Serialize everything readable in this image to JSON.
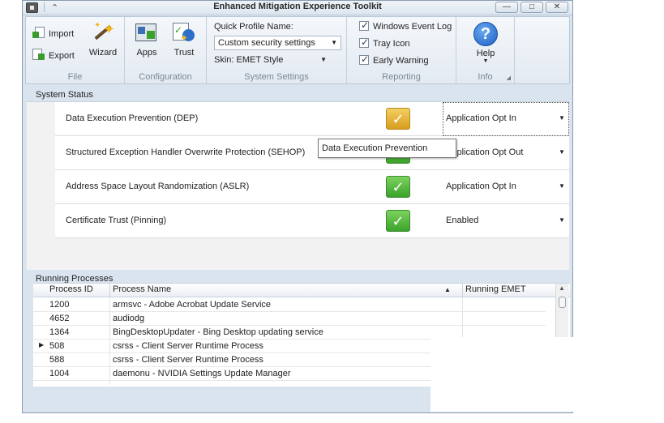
{
  "window": {
    "title": "Enhanced Mitigation Experience Toolkit",
    "controls": {
      "minimize": "—",
      "maximize": "□",
      "close": "✕"
    },
    "qat_arrow": "⌃"
  },
  "ribbon": {
    "file": {
      "label": "File",
      "import": "Import",
      "export": "Export",
      "wizard": "Wizard"
    },
    "configuration": {
      "label": "Configuration",
      "apps": "Apps",
      "trust": "Trust"
    },
    "system_settings": {
      "label": "System Settings",
      "quick_profile_label": "Quick Profile Name:",
      "quick_profile_value": "Custom security settings",
      "skin_label": "Skin: EMET Style"
    },
    "reporting": {
      "label": "Reporting",
      "windows_event_log": "Windows Event Log",
      "tray_icon": "Tray Icon",
      "early_warning": "Early Warning"
    },
    "info": {
      "label": "Info",
      "help": "Help"
    }
  },
  "system_status": {
    "header": "System Status",
    "rows": [
      {
        "name": "Data Execution Prevention (DEP)",
        "mode": "Application Opt In",
        "state": "warning"
      },
      {
        "name": "Structured Exception Handler Overwrite Protection (SEHOP)",
        "mode": "Application Opt Out",
        "state": "ok"
      },
      {
        "name": "Address Space Layout Randomization (ASLR)",
        "mode": "Application Opt In",
        "state": "ok"
      },
      {
        "name": "Certificate Trust (Pinning)",
        "mode": "Enabled",
        "state": "ok"
      }
    ],
    "tooltip": "Data Execution Prevention"
  },
  "running_processes": {
    "header": "Running Processes",
    "columns": [
      "Process ID",
      "Process Name",
      "Running EMET"
    ],
    "sort_indicator": "▲",
    "rows": [
      {
        "pid": "1200",
        "name": "armsvc - Adobe Acrobat Update Service",
        "emet": ""
      },
      {
        "pid": "4652",
        "name": "audiodg",
        "emet": ""
      },
      {
        "pid": "1364",
        "name": "BingDesktopUpdater - Bing Desktop updating service",
        "emet": ""
      },
      {
        "pid": "508",
        "name": "csrss - Client Server Runtime Process",
        "emet": ""
      },
      {
        "pid": "588",
        "name": "csrss - Client Server Runtime Process",
        "emet": ""
      },
      {
        "pid": "1004",
        "name": "daemonu - NVIDIA Settings Update Manager",
        "emet": ""
      }
    ],
    "current_row_marker": "▶"
  },
  "colors": {
    "window_bg": "#d9e4ef",
    "ok_green": "#3aa22a",
    "warn_yellow": "#d79e1e",
    "help_blue": "#1b5fc4"
  }
}
